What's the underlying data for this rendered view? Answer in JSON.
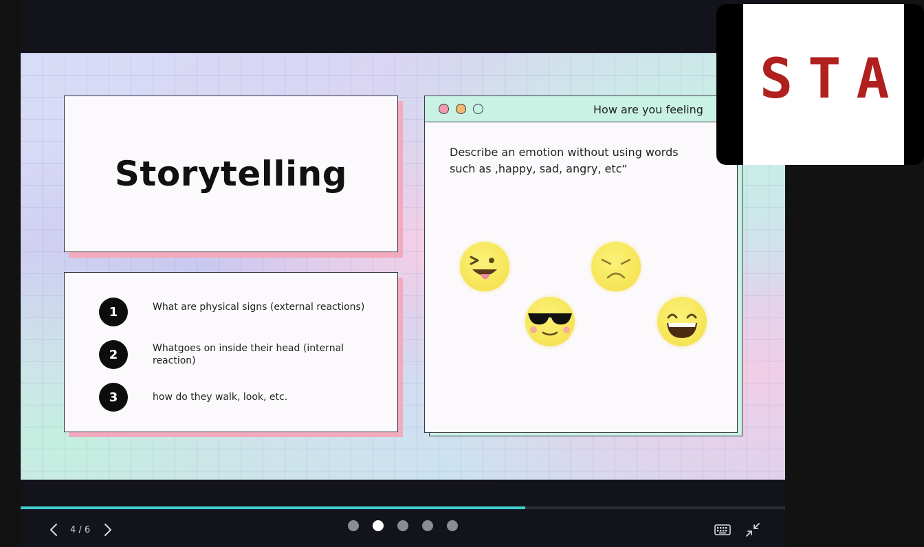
{
  "slide": {
    "title": "Storytelling",
    "steps": [
      {
        "number": "1",
        "text": "What are physical signs (external reactions)"
      },
      {
        "number": "2",
        "text": "Whatgoes on inside their head (internal reaction)"
      },
      {
        "number": "3",
        "text": "how do they walk, look, etc."
      }
    ],
    "prompt_window": {
      "title": "How are you feeling",
      "text": "Describe an emotion without using words such as ,happy, sad, angry, etc“",
      "dot_colors": [
        "#f19ab0",
        "#f2b86e",
        "#c9f2e4"
      ],
      "emojis": [
        "winking-tongue",
        "sad",
        "sunglasses",
        "grinning"
      ]
    }
  },
  "controls": {
    "page_indicator": "4 / 6",
    "progress": 0.66,
    "pager": {
      "count": 5,
      "active_index": 1
    },
    "accent_color": "#3fd0cf"
  },
  "pip": {
    "sign_text": "STA"
  }
}
